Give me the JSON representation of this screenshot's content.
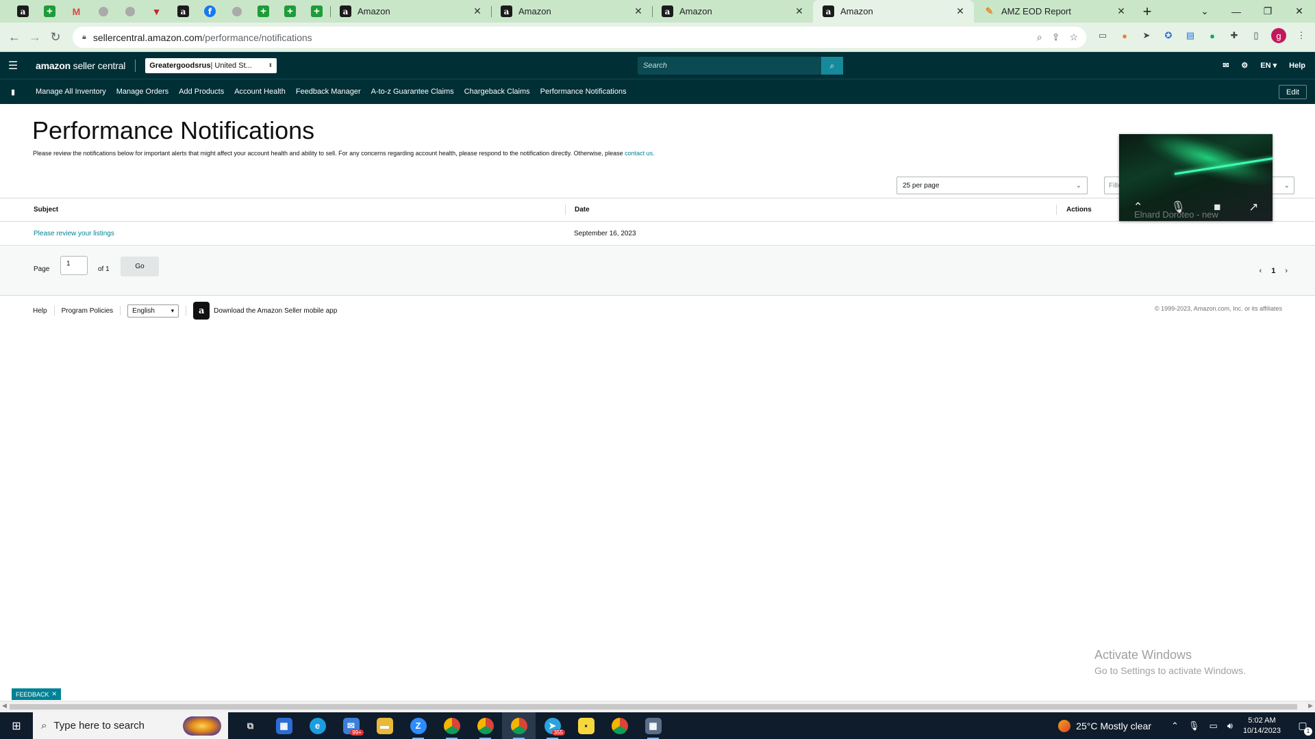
{
  "browser": {
    "tabs": [
      {
        "title": "Amazon",
        "active": false
      },
      {
        "title": "Amazon",
        "active": false
      },
      {
        "title": "Amazon",
        "active": false
      },
      {
        "title": "Amazon",
        "active": true
      },
      {
        "title": "AMZ EOD Report",
        "active": false
      }
    ],
    "url_host": "sellercentral.amazon.com",
    "url_path": "/performance/notifications"
  },
  "header": {
    "logo_brand": "amazon",
    "logo_product": "seller central",
    "store_name": "Greatergoodsrus",
    "store_market": " | United St...",
    "search_placeholder": "Search",
    "lang": "EN",
    "help": "Help"
  },
  "nav": {
    "items": [
      "Manage All Inventory",
      "Manage Orders",
      "Add Products",
      "Account Health",
      "Feedback Manager",
      "A-to-z Guarantee Claims",
      "Chargeback Claims",
      "Performance Notifications"
    ],
    "edit_label": "Edit"
  },
  "main": {
    "title": "Performance Notifications",
    "description": "Please review the notifications below for important alerts that might affect your account health and ability to sell. For any concerns regarding account health, please respond to the notification directly. Otherwise, please ",
    "contact_link": "contact us.",
    "per_page": "25 per page",
    "filter_placeholder": "Filte",
    "columns": {
      "subject": "Subject",
      "date": "Date",
      "actions": "Actions"
    },
    "rows": [
      {
        "subject": "Please review your listings",
        "date": "September 16, 2023"
      }
    ],
    "pagination": {
      "page_label": "Page",
      "page_value": "1",
      "of_label": "of 1",
      "go_label": "Go",
      "current": "1"
    }
  },
  "footer": {
    "help": "Help",
    "program_policies": "Program Policies",
    "language": "English",
    "app_download": "Download the Amazon Seller mobile app",
    "copyright": "© 1999-2023, Amazon.com, Inc. or its affiliates"
  },
  "video_call": {
    "caller": "Elnard Doroteo - new"
  },
  "watermark": {
    "line1": "Activate Windows",
    "line2": "Go to Settings to activate Windows."
  },
  "feedback": {
    "label": "FEEDBACK"
  },
  "taskbar": {
    "search_placeholder": "Type here to search",
    "mail_badge": "99+",
    "telegram_badge": "355",
    "weather": "25°C  Mostly clear",
    "time": "5:02 AM",
    "date": "10/14/2023",
    "notification_count": "1"
  }
}
